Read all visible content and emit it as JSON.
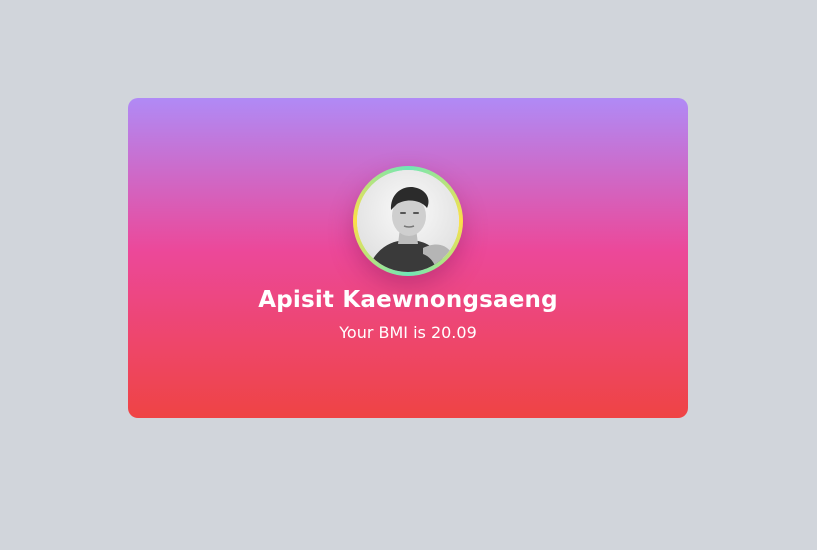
{
  "profile": {
    "name": "Apisit Kaewnongsaeng",
    "bmi_text": "Your BMI is 20.09"
  },
  "colors": {
    "page_background": "#d1d5db",
    "gradient_top": "#b08af6",
    "gradient_middle": "#ec4899",
    "gradient_bottom": "#ef4444",
    "avatar_ring_primary": "#6ee7b7",
    "avatar_ring_secondary": "#fde047",
    "text": "#ffffff"
  },
  "icons": {
    "avatar": "profile-photo"
  }
}
